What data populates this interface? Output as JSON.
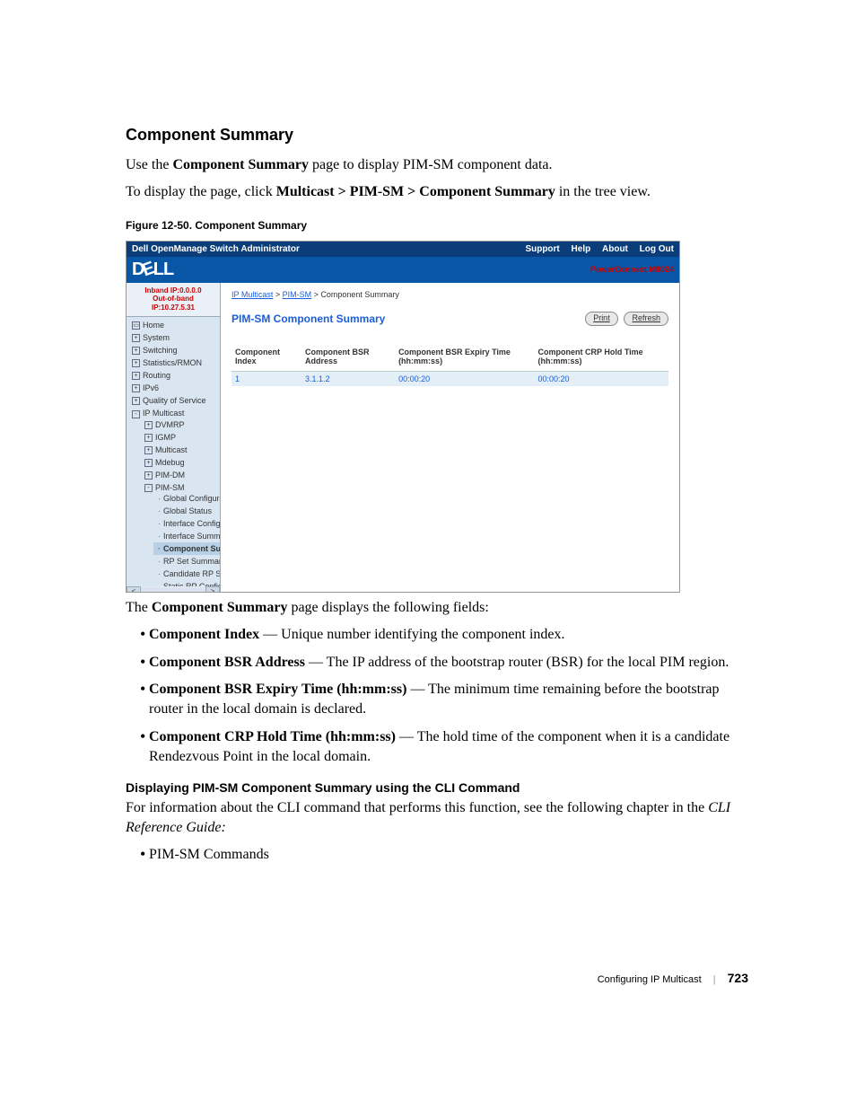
{
  "section": {
    "title": "Component Summary"
  },
  "intro1_a": "Use the ",
  "intro1_b": "Component Summary",
  "intro1_c": " page to display PIM-SM component data.",
  "intro2_a": "To display the page, click ",
  "intro2_b": "Multicast > PIM-SM > Component Summary",
  "intro2_c": " in the tree view.",
  "figcap": "Figure 12-50.    Component Summary",
  "app": {
    "title": "Dell OpenManage Switch Administrator",
    "title_links": [
      "Support",
      "Help",
      "About",
      "Log Out"
    ],
    "brand": {
      "logo_pre": "D",
      "logo_e": "E",
      "logo_post": "LL",
      "product": "PowerConnect M8024"
    },
    "ip1": "Inband IP:0.0.0.0",
    "ip2": "Out-of-band IP:10.27.5.31",
    "tree": {
      "home": "Home",
      "items": [
        {
          "t": "System",
          "icon": "+"
        },
        {
          "t": "Switching",
          "icon": "+"
        },
        {
          "t": "Statistics/RMON",
          "icon": "+"
        },
        {
          "t": "Routing",
          "icon": "+"
        },
        {
          "t": "IPv6",
          "icon": "+"
        },
        {
          "t": "Quality of Service",
          "icon": "+"
        },
        {
          "t": "IP Multicast",
          "icon": "-",
          "children": [
            {
              "t": "DVMRP",
              "icon": "+"
            },
            {
              "t": "IGMP",
              "icon": "+"
            },
            {
              "t": "Multicast",
              "icon": "+"
            },
            {
              "t": "Mdebug",
              "icon": "+"
            },
            {
              "t": "PIM-DM",
              "icon": "+"
            },
            {
              "t": "PIM-SM",
              "icon": "-",
              "children": [
                {
                  "t": "Global Configuration"
                },
                {
                  "t": "Global Status"
                },
                {
                  "t": "Interface Configuration"
                },
                {
                  "t": "Interface Summary"
                },
                {
                  "t": "Component Summa",
                  "sel": true
                },
                {
                  "t": "RP Set Summary"
                },
                {
                  "t": "Candidate RP Summ"
                },
                {
                  "t": "Static RP Configurati"
                }
              ]
            }
          ]
        }
      ]
    },
    "crumb": {
      "a": "IP Multicast",
      "b": "PIM-SM",
      "c": "Component Summary"
    },
    "content_title": "PIM-SM Component Summary",
    "btn_print": "Print",
    "btn_refresh": "Refresh",
    "table": {
      "h1": "Component Index",
      "h2": "Component BSR Address",
      "h3": "Component BSR Expiry Time (hh:mm:ss)",
      "h4": "Component CRP Hold Time (hh:mm:ss)",
      "rows": [
        {
          "c1": "1",
          "c2": "3.1.1.2",
          "c3": "00:00:20",
          "c4": "00:00:20"
        }
      ]
    }
  },
  "post_fig": {
    "a": "The ",
    "b": "Component Summary",
    "c": " page displays the following fields:"
  },
  "fields": [
    {
      "b": "Component Index",
      "t": " — Unique number identifying the component index."
    },
    {
      "b": "Component BSR Address",
      "t": " — The IP address of the bootstrap router (BSR) for the local PIM region."
    },
    {
      "b": "Component BSR Expiry Time (hh:mm:ss)",
      "t": " — The minimum time remaining before the bootstrap router in the local domain is declared."
    },
    {
      "b": "Component CRP Hold Time (hh:mm:ss)",
      "t": " — The hold time of the component when it is a candidate Rendezvous Point in the local domain."
    }
  ],
  "subsec": "Displaying PIM-SM Component Summary using the CLI Command",
  "cli_a": "For information about the CLI command that performs this function, see the following chapter in the ",
  "cli_b": "CLI Reference Guide:",
  "cli_list": [
    "PIM-SM Commands"
  ],
  "footer": {
    "chap": "Configuring IP Multicast",
    "page": "723"
  }
}
